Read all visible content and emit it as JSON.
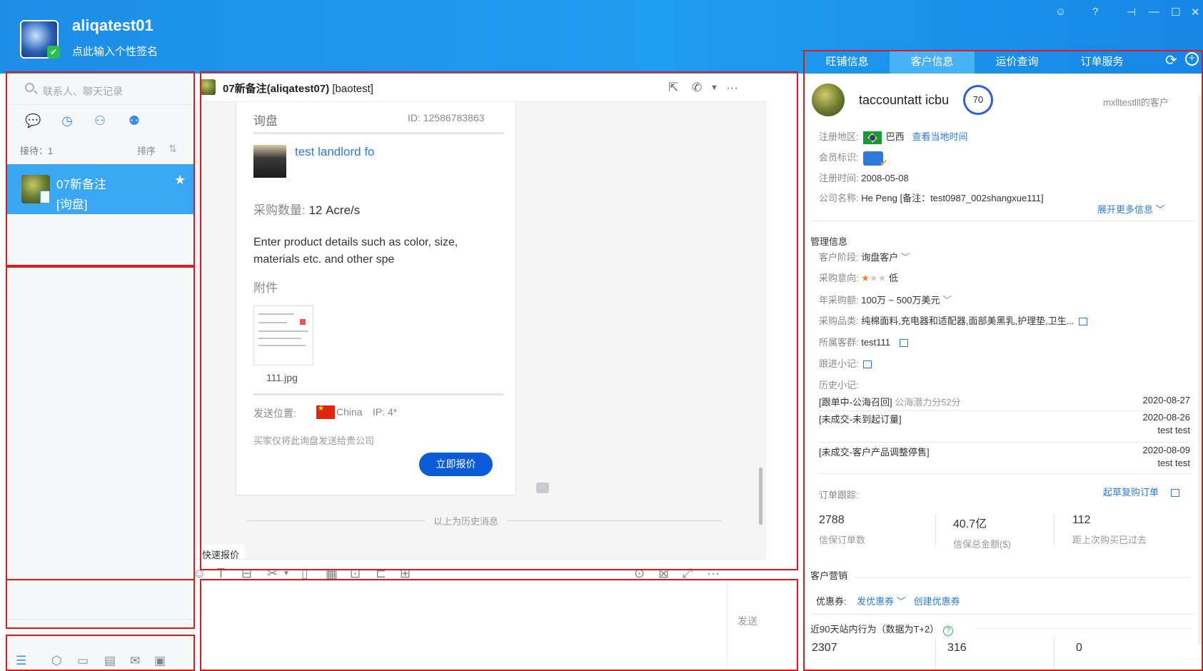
{
  "header": {
    "user_name": "aliqatest01",
    "signature": "点此输入个性签名"
  },
  "tabs": [
    {
      "label": "旺铺信息",
      "active": false
    },
    {
      "label": "客户信息",
      "active": true
    },
    {
      "label": "运价查询",
      "active": false
    },
    {
      "label": "订单服务",
      "active": false
    }
  ],
  "sidebar": {
    "search_placeholder": "联系人、聊天记录",
    "reception_label": "接待：1",
    "sort_label": "排序",
    "session": {
      "name": "07新备注",
      "tag": "[询盘]"
    }
  },
  "chat": {
    "title_name": "07新备注(aliqatest07)",
    "title_tag": "[baotest]",
    "card": {
      "type": "询盘",
      "id_text": "ID:   12586783863",
      "product_name": "test landlord fo",
      "qty_label": "采购数量: ",
      "qty_value": "12 Acre/s",
      "description": "Enter product details such as color, size, materials etc. and other spe",
      "attachment_label": "附件",
      "attachment_name": "111.jpg",
      "sender_label": "发送位置:",
      "sender_country": "China",
      "sender_ip": "IP: 4*",
      "visibility_note": "买家仅将此询盘发送给贵公司",
      "quote_button": "立即报价"
    },
    "more_dots": "···",
    "history_divider": "以上为历史消息",
    "quick_quote": "快速报价",
    "send_label": "发送"
  },
  "customer": {
    "name": "taccountatt icbu",
    "score": "70",
    "owner": "mxlltestlll的客户",
    "region_label": "注册地区:",
    "region_value": "巴西",
    "local_time_link": "查看当地时间",
    "member_label": "会员标识:",
    "reg_time_label": "注册时间:",
    "reg_time_value": "2008-05-08",
    "company_label": "公司名称:",
    "company_value": "He Peng  [备注：test0987_002shangxue111]",
    "expand_link": "展开更多信息",
    "manage_title": "管理信息",
    "stage_label": "客户阶段:",
    "stage_value": "询盘客户",
    "intent_label": "采购意向:",
    "intent_level": "低",
    "intent_stars": 1,
    "annual_label": "年采购额:",
    "annual_value": "100万 ~ 500万美元",
    "category_label": "采购品类:",
    "category_value": "纯棉面料,充电器和适配器,面部美黑乳,护理垫,卫生...",
    "group_label": "所属客群:",
    "group_value": "test111",
    "followup_label": "跟进小记:",
    "history_label": "历史小记:",
    "notes": [
      {
        "text": "[跟单中-公海召回]",
        "extra": "公海潜力分52分",
        "date": "2020-08-27",
        "user": ""
      },
      {
        "text": "[未成交-未到起订量]",
        "extra": "",
        "date": "2020-08-26",
        "user": "test test"
      },
      {
        "text": "[未成交-客户产品调整停售]",
        "extra": "",
        "date": "2020-08-09",
        "user": "test test"
      }
    ],
    "order_label": "订单跟踪:",
    "reorder_link": "起草复购订单",
    "order_stats": [
      {
        "value": "2788",
        "label": "信保订单数"
      },
      {
        "value": "40.7亿",
        "label": "信保总金额($)"
      },
      {
        "value": "112",
        "label": "距上次购买已过去"
      }
    ],
    "marketing_title": "客户营销",
    "coupon_label": "优惠券:",
    "coupon_send": "发优惠券",
    "coupon_create": "创建优惠券",
    "behavior_title": "近90天站内行为（数据为T+2）",
    "behavior_stats": [
      "2307",
      "316",
      "0"
    ]
  }
}
